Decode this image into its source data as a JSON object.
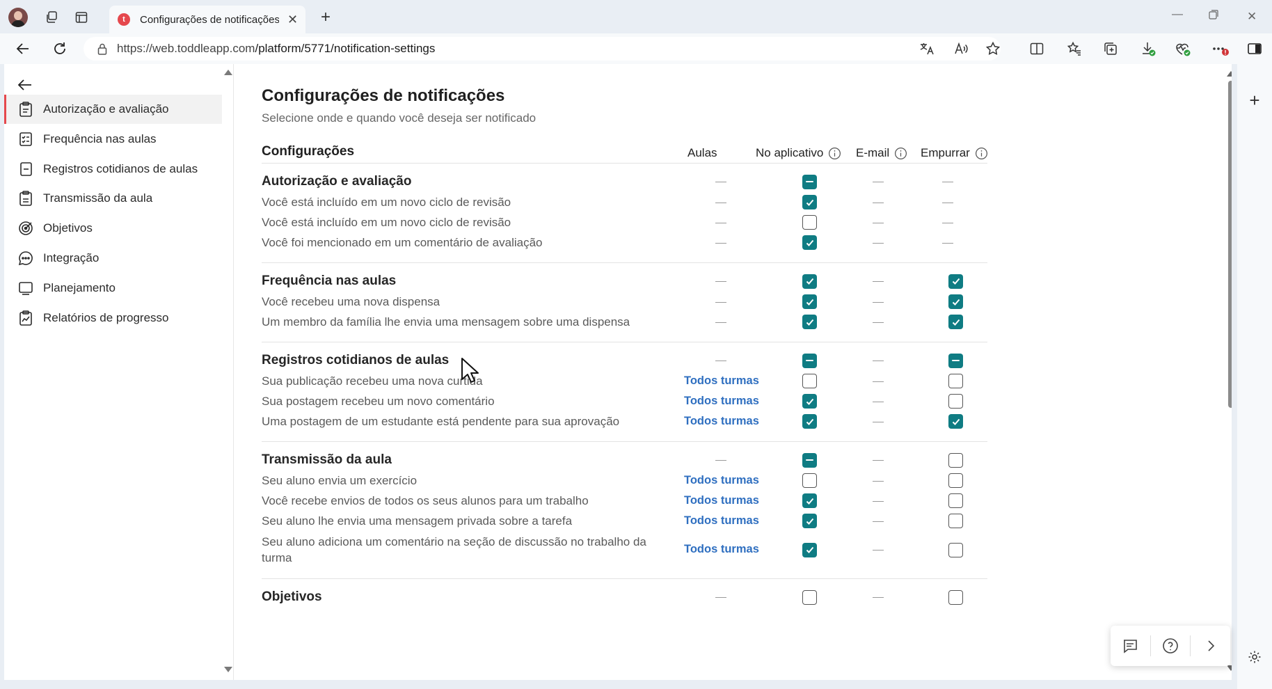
{
  "browser": {
    "tab_title": "Configurações de notificações",
    "tab_favicon": "t",
    "url_host": "https://web.toddleapp.com",
    "url_path": "/platform/5771/notification-settings",
    "accent": "#e5484d"
  },
  "sidebar": {
    "items": [
      {
        "label": "Autorização e avaliação",
        "icon": "clipboard-icon",
        "active": true
      },
      {
        "label": "Frequência nas aulas",
        "icon": "attendance-icon"
      },
      {
        "label": "Registros cotidianos de aulas",
        "icon": "journal-icon"
      },
      {
        "label": "Transmissão da aula",
        "icon": "stream-icon"
      },
      {
        "label": "Objetivos",
        "icon": "target-icon"
      },
      {
        "label": "Integração",
        "icon": "chat-icon"
      },
      {
        "label": "Planejamento",
        "icon": "planning-icon"
      },
      {
        "label": "Relatórios de progresso",
        "icon": "report-icon"
      }
    ]
  },
  "content": {
    "title": "Configurações de notificações",
    "subtitle": "Selecione onde e quando você deseja ser notificado",
    "settings_header": "Configurações",
    "columns": {
      "classes": "Aulas",
      "in_app": "No aplicativo",
      "email": "E-mail",
      "push": "Empurrar"
    },
    "all_classes_label": "Todos turmas",
    "checkbox_color": "#0f7c83",
    "link_color": "#2f6fc0"
  },
  "groups": [
    {
      "title": "Autorização e avaliação",
      "section_state": {
        "classes": "-",
        "in_app": "mixed",
        "email": "-",
        "push": "-"
      },
      "rows": [
        {
          "label": "Você está incluído em um novo ciclo de revisão",
          "classes": "-",
          "in_app": "on",
          "email": "-",
          "push": "-"
        },
        {
          "label": "Você está incluído em um novo ciclo de revisão",
          "classes": "-",
          "in_app": "off",
          "email": "-",
          "push": "-"
        },
        {
          "label": "Você foi mencionado em um comentário de avaliação",
          "classes": "-",
          "in_app": "on",
          "email": "-",
          "push": "-"
        }
      ]
    },
    {
      "title": "Frequência nas aulas",
      "section_state": {
        "classes": "-",
        "in_app": "on",
        "email": "-",
        "push": "on"
      },
      "rows": [
        {
          "label": "Você recebeu uma nova dispensa",
          "classes": "-",
          "in_app": "on",
          "email": "-",
          "push": "on"
        },
        {
          "label": "Um membro da família lhe envia uma mensagem sobre uma dispensa",
          "classes": "-",
          "in_app": "on",
          "email": "-",
          "push": "on"
        }
      ]
    },
    {
      "title": "Registros cotidianos de aulas",
      "section_state": {
        "classes": "-",
        "in_app": "mixed",
        "email": "-",
        "push": "mixed"
      },
      "rows": [
        {
          "label": "Sua publicação recebeu uma nova curtida",
          "classes": "link",
          "in_app": "off",
          "email": "-",
          "push": "off"
        },
        {
          "label": "Sua postagem recebeu um novo comentário",
          "classes": "link",
          "in_app": "on",
          "email": "-",
          "push": "off"
        },
        {
          "label": "Uma postagem de um estudante está pendente para sua aprovação",
          "classes": "link",
          "in_app": "on",
          "email": "-",
          "push": "on"
        }
      ]
    },
    {
      "title": "Transmissão da aula",
      "section_state": {
        "classes": "-",
        "in_app": "mixed",
        "email": "-",
        "push": "off"
      },
      "rows": [
        {
          "label": "Seu aluno envia um exercício",
          "classes": "link",
          "in_app": "off",
          "email": "-",
          "push": "off"
        },
        {
          "label": "Você recebe envios de todos os seus alunos para um trabalho",
          "classes": "link",
          "in_app": "on",
          "email": "-",
          "push": "off"
        },
        {
          "label": "Seu aluno lhe envia uma mensagem privada sobre a tarefa",
          "classes": "link",
          "in_app": "on",
          "email": "-",
          "push": "off"
        },
        {
          "label": "Seu aluno adiciona um comentário na seção de discussão no trabalho da turma",
          "classes": "link",
          "in_app": "on",
          "email": "-",
          "push": "off"
        }
      ]
    },
    {
      "title": "Objetivos",
      "section_state": {
        "classes": "-",
        "in_app": "off",
        "email": "-",
        "push": "off"
      },
      "rows": []
    }
  ]
}
